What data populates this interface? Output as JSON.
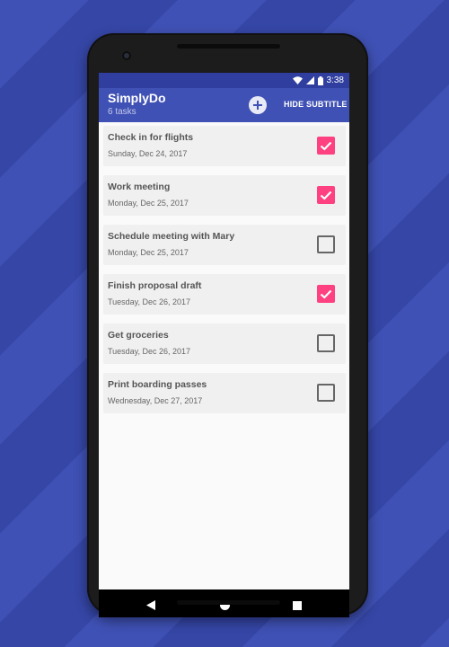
{
  "status_bar": {
    "time": "3:38",
    "wifi_icon": "wifi-icon",
    "signal_icon": "signal-icon",
    "battery_icon": "battery-icon"
  },
  "app_bar": {
    "title": "SimplyDo",
    "subtitle": "6 tasks",
    "add_icon": "add-circle-icon",
    "hide_subtitle_label": "HIDE SUBTITLE"
  },
  "tasks": [
    {
      "title": "Check in for flights",
      "date": "Sunday, Dec 24, 2017",
      "done": true
    },
    {
      "title": "Work meeting",
      "date": "Monday, Dec 25, 2017",
      "done": true
    },
    {
      "title": "Schedule meeting with Mary",
      "date": "Monday, Dec 25, 2017",
      "done": false
    },
    {
      "title": "Finish proposal draft",
      "date": "Tuesday, Dec 26, 2017",
      "done": true
    },
    {
      "title": "Get groceries",
      "date": "Tuesday, Dec 26, 2017",
      "done": false
    },
    {
      "title": "Print boarding passes",
      "date": "Wednesday, Dec 27, 2017",
      "done": false
    }
  ],
  "nav_bar": {
    "back_icon": "back-triangle-icon",
    "home_icon": "home-circle-icon",
    "recents_icon": "recents-square-icon"
  },
  "colors": {
    "primary": "#3f51b5",
    "primary_dark": "#303f9f",
    "accent": "#ff4081",
    "background_stripes": [
      "#3f51b5",
      "#3546a6"
    ]
  }
}
